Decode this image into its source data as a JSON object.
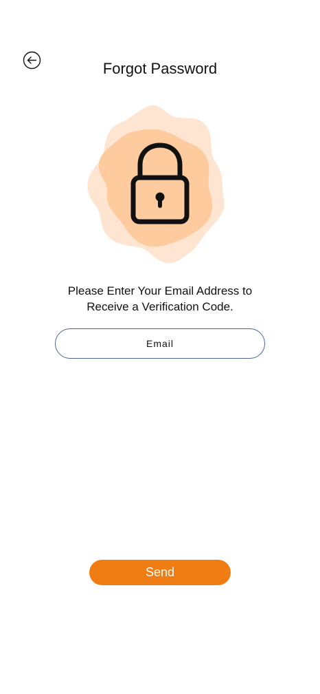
{
  "header": {
    "title": "Forgot Password",
    "back_icon": "arrow-left-circle-icon"
  },
  "illustration": {
    "icon": "lock-icon",
    "colors": {
      "blob_light": "#fde5d2",
      "blob_dark": "#fdcb9e",
      "lock_stroke": "#111111"
    }
  },
  "instruction": {
    "line1": "Please Enter Your Email Address to",
    "line2": "Receive a Verification Code."
  },
  "form": {
    "email_placeholder": "Email",
    "email_value": ""
  },
  "actions": {
    "send_label": "Send"
  },
  "colors": {
    "accent": "#f07c14",
    "input_border": "#4a6491",
    "background": "#ffffff"
  }
}
